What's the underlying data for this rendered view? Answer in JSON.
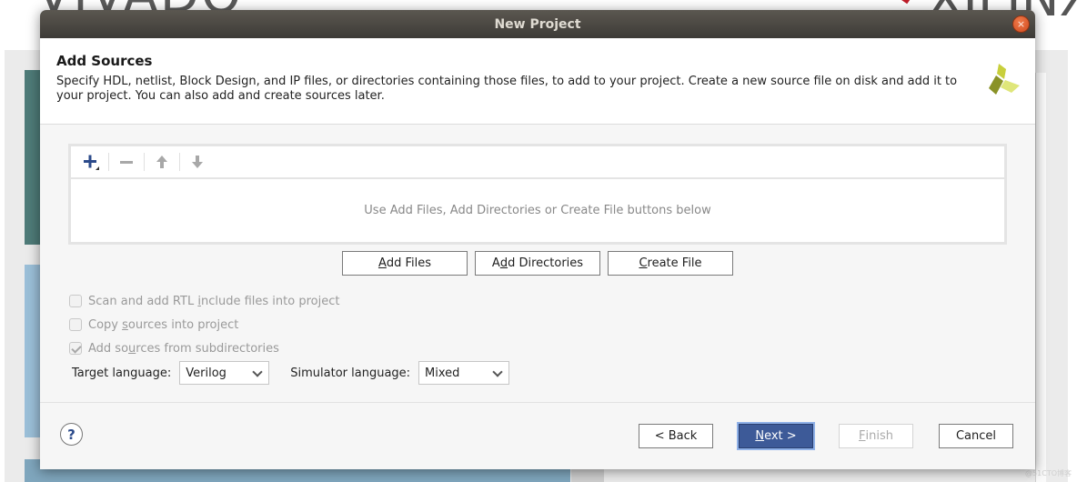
{
  "background": {
    "vivado_logo": "VIVADO",
    "xilinx_logo": "XILINX",
    "xilinx_reg": "®",
    "watermark": "@51CTO博客"
  },
  "dialog": {
    "title": "New Project",
    "close_icon": "×",
    "header": {
      "heading": "Add Sources",
      "description": "Specify HDL, netlist, Block Design, and IP files, or directories containing those files, to add to your project. Create a new source file on disk and add it to your project. You can also add and create sources later."
    },
    "sources": {
      "toolbar": {
        "add_icon": "plus-icon",
        "remove_icon": "minus-icon",
        "up_icon": "arrow-up-icon",
        "down_icon": "arrow-down-icon"
      },
      "empty_message": "Use Add Files, Add Directories or Create File buttons below"
    },
    "file_buttons": {
      "add_files": {
        "mnemonic": "A",
        "rest": "dd Files"
      },
      "add_directories": {
        "pre": "A",
        "mnemonic": "d",
        "rest": "d Directories"
      },
      "create_file": {
        "mnemonic": "C",
        "rest": "reate File"
      }
    },
    "options": [
      {
        "pre": "Scan and add RTL ",
        "mnemonic": "i",
        "rest": "nclude files into project",
        "checked": false,
        "enabled": false
      },
      {
        "pre": "Copy ",
        "mnemonic": "s",
        "rest": "ources into project",
        "checked": false,
        "enabled": false
      },
      {
        "pre": "Add so",
        "mnemonic": "u",
        "rest": "rces from subdirectories",
        "checked": true,
        "enabled": false
      }
    ],
    "target_language": {
      "label": "Target language:",
      "value": "Verilog"
    },
    "simulator_language": {
      "label": "Simulator language:",
      "value": "Mixed"
    },
    "footer": {
      "help_icon": "?",
      "back": "< Back",
      "next": {
        "mnemonic": "N",
        "rest": "ext >"
      },
      "finish": {
        "mnemonic": "F",
        "rest": "inish"
      },
      "cancel": "Cancel"
    }
  }
}
